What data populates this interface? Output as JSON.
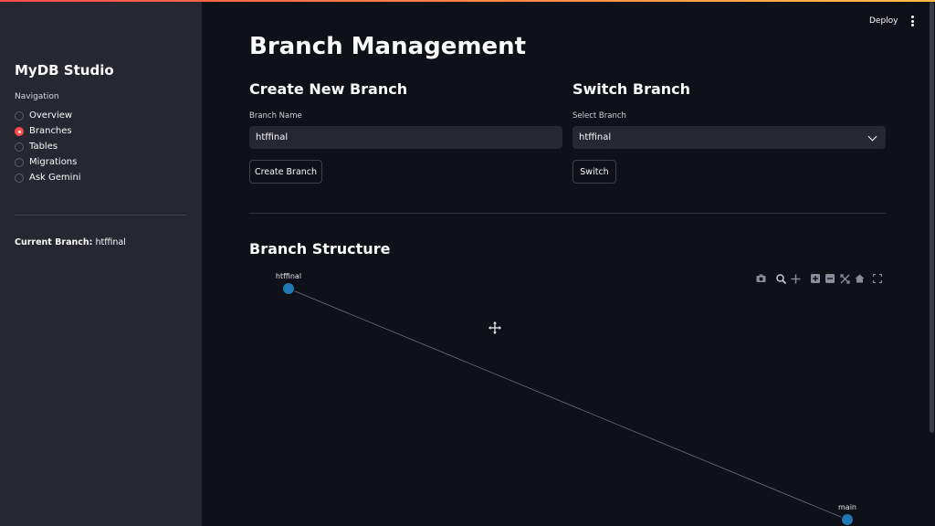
{
  "sidebar": {
    "app_title": "MyDB Studio",
    "nav_label": "Navigation",
    "nav_items": [
      {
        "label": "Overview",
        "selected": false
      },
      {
        "label": "Branches",
        "selected": true
      },
      {
        "label": "Tables",
        "selected": false
      },
      {
        "label": "Migrations",
        "selected": false
      },
      {
        "label": "Ask Gemini",
        "selected": false
      }
    ],
    "current_branch_label": "Current Branch:",
    "current_branch_value": "htffinal"
  },
  "header": {
    "deploy_label": "Deploy"
  },
  "main": {
    "page_title": "Branch Management",
    "create": {
      "title": "Create New Branch",
      "field_label": "Branch Name",
      "field_value": "htffinal",
      "button_label": "Create Branch"
    },
    "switch": {
      "title": "Switch Branch",
      "field_label": "Select Branch",
      "selected_value": "htffinal",
      "button_label": "Switch"
    },
    "structure_title": "Branch Structure"
  },
  "modebar_icons": [
    "camera-icon",
    "zoom-icon",
    "pan-icon",
    "zoom-in-icon",
    "zoom-out-icon",
    "autoscale-icon",
    "reset-axes-icon",
    "fullscreen-icon"
  ],
  "colors": {
    "accent": "#ff4b4b",
    "node": "#1f77b4",
    "background": "#0e1117",
    "sidebar": "#262730"
  },
  "chart_data": {
    "type": "scatter",
    "nodes": [
      {
        "name": "htffinal"
      },
      {
        "name": "main"
      }
    ],
    "edges": [
      [
        "htffinal",
        "main"
      ]
    ]
  }
}
